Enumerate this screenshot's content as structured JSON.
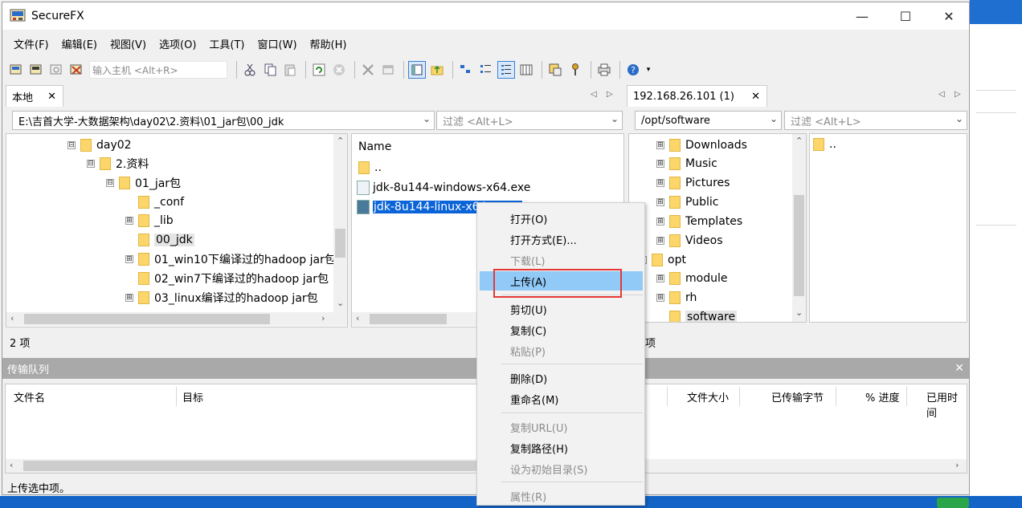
{
  "app": {
    "title": "SecureFX"
  },
  "window_controls": {
    "minimize": "—",
    "maximize": "☐",
    "close": "✕"
  },
  "menu": [
    "文件(F)",
    "编辑(E)",
    "视图(V)",
    "选项(O)",
    "工具(T)",
    "窗口(W)",
    "帮助(H)"
  ],
  "toolbar": {
    "host_placeholder": "输入主机 <Alt+R>"
  },
  "local": {
    "tab_label": "本地",
    "tab_close": "✕",
    "path": "E:\\吉首大学-大数据架构\\day02\\2.资料\\01_jar包\\00_jdk",
    "filter_placeholder": "过滤 <Alt+L>",
    "tree": [
      {
        "label": "day02",
        "expander": "⊟"
      },
      {
        "label": "2.资料",
        "expander": "⊟"
      },
      {
        "label": "01_jar包",
        "expander": "⊟"
      },
      {
        "label": "_conf",
        "expander": ""
      },
      {
        "label": "_lib",
        "expander": "⊞"
      },
      {
        "label": "00_jdk",
        "expander": ""
      },
      {
        "label": "01_win10下编译过的hadoop jar包",
        "expander": "⊞"
      },
      {
        "label": "02_win7下编译过的hadoop jar包",
        "expander": ""
      },
      {
        "label": "03_linux编译过的hadoop jar包",
        "expander": "⊞"
      }
    ],
    "files_header": "Name",
    "files": [
      "..",
      "jdk-8u144-windows-x64.exe",
      "jdk-8u144-linux-x64.tar.gz"
    ],
    "status": "2 项"
  },
  "remote": {
    "tab_label": "192.168.26.101 (1)",
    "tab_close": "✕",
    "path": "/opt/software",
    "filter_placeholder": "过滤 <Alt+L>",
    "tree": [
      {
        "label": "Downloads",
        "expander": "⊞"
      },
      {
        "label": "Music",
        "expander": "⊞"
      },
      {
        "label": "Pictures",
        "expander": "⊞"
      },
      {
        "label": "Public",
        "expander": "⊞"
      },
      {
        "label": "Templates",
        "expander": "⊞"
      },
      {
        "label": "Videos",
        "expander": "⊞"
      },
      {
        "label": "opt",
        "expander": "⊟"
      },
      {
        "label": "module",
        "expander": "⊞"
      },
      {
        "label": "rh",
        "expander": "⊞"
      },
      {
        "label": "software",
        "expander": ""
      }
    ],
    "files": [
      ".."
    ],
    "status": "项"
  },
  "transfer_queue": {
    "title": "传输队列",
    "close": "✕",
    "columns": [
      "文件名",
      "目标",
      "文件大小",
      "已传输字节",
      "% 进度",
      "已用时间"
    ]
  },
  "context_menu": {
    "items": [
      {
        "label": "打开(O)",
        "disabled": false
      },
      {
        "label": "打开方式(E)...",
        "disabled": false
      },
      {
        "label": "下载(L)",
        "disabled": true
      },
      {
        "label": "上传(A)",
        "disabled": false,
        "highlighted": true
      },
      {
        "label": "剪切(U)",
        "disabled": false
      },
      {
        "label": "复制(C)",
        "disabled": false
      },
      {
        "label": "粘贴(P)",
        "disabled": true
      },
      {
        "label": "删除(D)",
        "disabled": false
      },
      {
        "label": "重命名(M)",
        "disabled": false
      },
      {
        "label": "复制URL(U)",
        "disabled": true
      },
      {
        "label": "复制路径(H)",
        "disabled": false
      },
      {
        "label": "设为初始目录(S)",
        "disabled": true
      },
      {
        "label": "属性(R)",
        "disabled": true
      }
    ]
  },
  "statusbar": {
    "text": "上传选中项。"
  },
  "colors": {
    "selection": "#0a64d8",
    "menu_highlight": "#91c9f7",
    "annotation_box": "#e53935",
    "folder": "#fcd66b"
  }
}
